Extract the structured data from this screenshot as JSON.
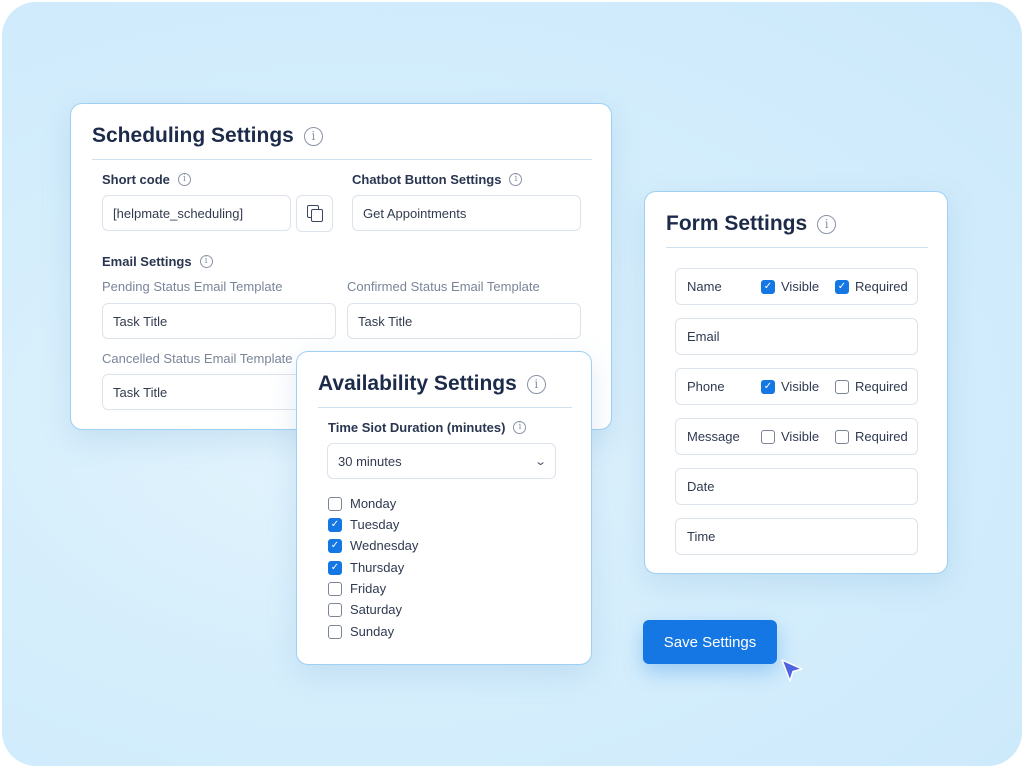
{
  "scheduling": {
    "title": "Scheduling Settings",
    "short_code_label": "Short code",
    "short_code_value": "[helpmate_scheduling]",
    "chatbot_label": "Chatbot Button Settings",
    "chatbot_value": "Get Appointments",
    "email_label": "Email Settings",
    "pending_label": "Pending Status Email Template",
    "pending_value": "Task Title",
    "confirmed_label": "Confirmed Status Email Template",
    "confirmed_value": "Task Title",
    "cancelled_label": "Cancelled Status Email Template",
    "cancelled_value": "Task Title"
  },
  "availability": {
    "title": "Availability Settings",
    "duration_label": "Time Siot Duration (minutes)",
    "duration_value": "30 minutes",
    "days": [
      {
        "label": "Monday",
        "checked": false
      },
      {
        "label": "Tuesday",
        "checked": true
      },
      {
        "label": "Wednesday",
        "checked": true
      },
      {
        "label": "Thursday",
        "checked": true
      },
      {
        "label": "Friday",
        "checked": false
      },
      {
        "label": "Saturday",
        "checked": false
      },
      {
        "label": "Sunday",
        "checked": false
      }
    ]
  },
  "form": {
    "title": "Form Settings",
    "visible_label": "Visible",
    "required_label": "Required",
    "fields": [
      {
        "name": "Name",
        "visible": true,
        "required": true,
        "has_options": true
      },
      {
        "name": "Email",
        "has_options": false
      },
      {
        "name": "Phone",
        "visible": true,
        "required": false,
        "has_options": true
      },
      {
        "name": "Message",
        "visible": false,
        "required": false,
        "has_options": true
      },
      {
        "name": "Date",
        "has_options": false
      },
      {
        "name": "Time",
        "has_options": false
      }
    ]
  },
  "save_button": "Save Settings",
  "colors": {
    "accent": "#1577e4",
    "card_border": "#9fd0f3",
    "background": "#d5eefc"
  }
}
